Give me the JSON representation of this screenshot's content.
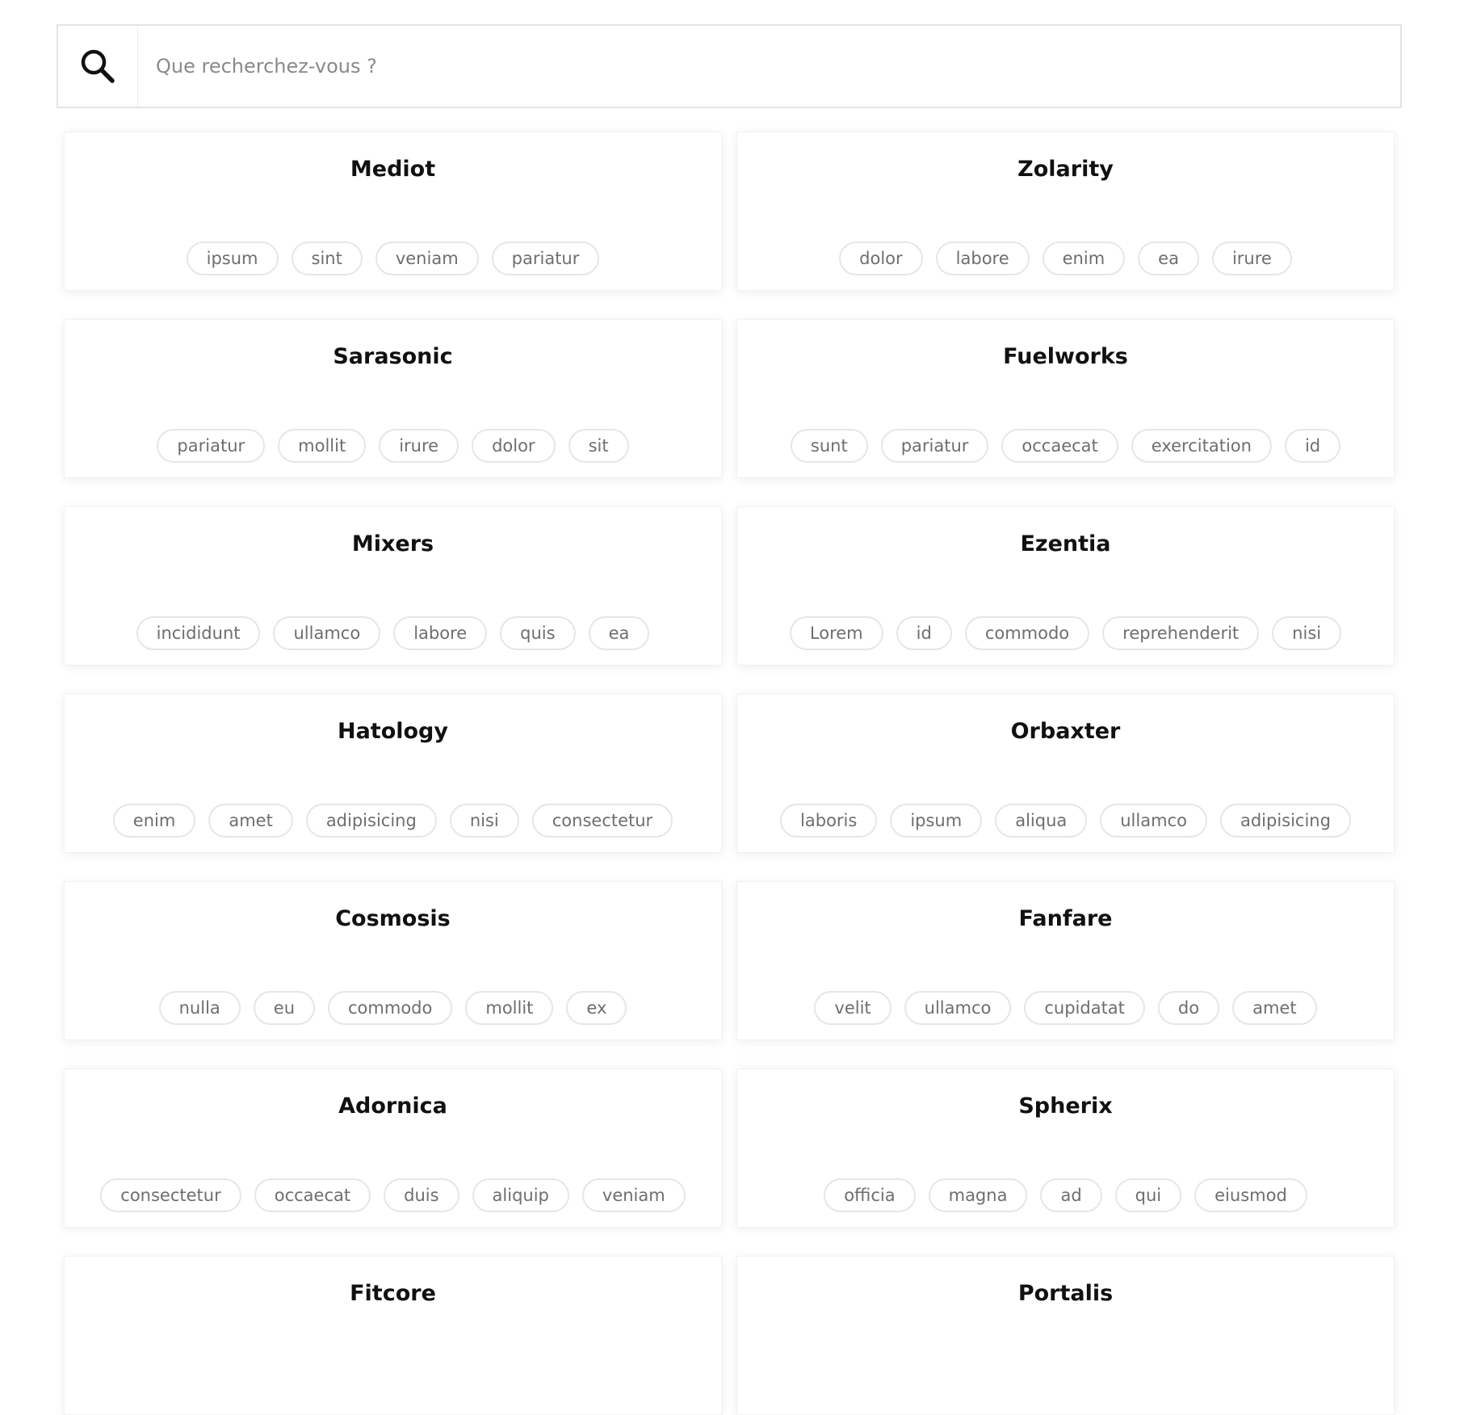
{
  "search": {
    "placeholder": "Que recherchez-vous ?",
    "icon": "search-icon"
  },
  "cards": [
    {
      "title": "Mediot",
      "tags": [
        "ipsum",
        "sint",
        "veniam",
        "pariatur"
      ]
    },
    {
      "title": "Zolarity",
      "tags": [
        "dolor",
        "labore",
        "enim",
        "ea",
        "irure"
      ]
    },
    {
      "title": "Sarasonic",
      "tags": [
        "pariatur",
        "mollit",
        "irure",
        "dolor",
        "sit"
      ]
    },
    {
      "title": "Fuelworks",
      "tags": [
        "sunt",
        "pariatur",
        "occaecat",
        "exercitation",
        "id"
      ]
    },
    {
      "title": "Mixers",
      "tags": [
        "incididunt",
        "ullamco",
        "labore",
        "quis",
        "ea"
      ]
    },
    {
      "title": "Ezentia",
      "tags": [
        "Lorem",
        "id",
        "commodo",
        "reprehenderit",
        "nisi"
      ]
    },
    {
      "title": "Hatology",
      "tags": [
        "enim",
        "amet",
        "adipisicing",
        "nisi",
        "consectetur"
      ]
    },
    {
      "title": "Orbaxter",
      "tags": [
        "laboris",
        "ipsum",
        "aliqua",
        "ullamco",
        "adipisicing"
      ]
    },
    {
      "title": "Cosmosis",
      "tags": [
        "nulla",
        "eu",
        "commodo",
        "mollit",
        "ex"
      ]
    },
    {
      "title": "Fanfare",
      "tags": [
        "velit",
        "ullamco",
        "cupidatat",
        "do",
        "amet"
      ]
    },
    {
      "title": "Adornica",
      "tags": [
        "consectetur",
        "occaecat",
        "duis",
        "aliquip",
        "veniam"
      ]
    },
    {
      "title": "Spherix",
      "tags": [
        "officia",
        "magna",
        "ad",
        "qui",
        "eiusmod"
      ]
    },
    {
      "title": "Fitcore",
      "tags": []
    },
    {
      "title": "Portalis",
      "tags": []
    }
  ]
}
